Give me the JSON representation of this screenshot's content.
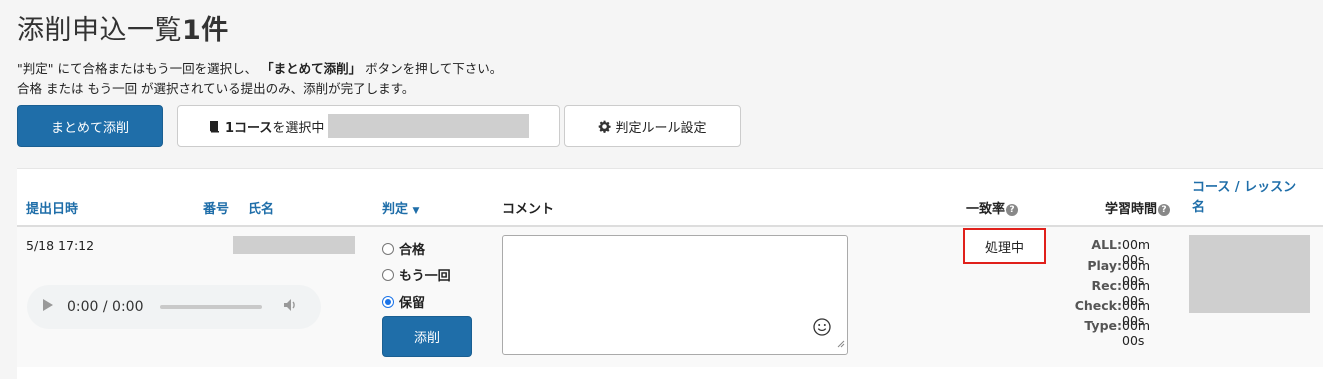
{
  "page": {
    "title": "添削申込一覧",
    "count": "1件"
  },
  "instructions": {
    "line1_a": "\"判定\" にて合格またはもう一回を選択し、",
    "line1_b": "「まとめて添削」",
    "line1_c": " ボタンを押して下さい。",
    "line2": "合格 または もう一回 が選択されている提出のみ、添削が完了します。"
  },
  "toolbar": {
    "bulk_label": "まとめて添削",
    "course_count": "1コース",
    "course_suffix": "を選択中",
    "rule_label": "判定ルール設定"
  },
  "table": {
    "headers": {
      "date": "提出日時",
      "number": "番号",
      "name": "氏名",
      "judgement": "判定",
      "comment": "コメント",
      "match_rate": "一致率",
      "study_time": "学習時間",
      "course_lesson_1": "コース / レッスン",
      "course_lesson_2": "名"
    },
    "rows": [
      {
        "date": "5/18 17:12",
        "audio_time": "0:00 / 0:00",
        "options": [
          {
            "label": "合格",
            "selected": false
          },
          {
            "label": "もう一回",
            "selected": false
          },
          {
            "label": "保留",
            "selected": true
          }
        ],
        "correct_label": "添削",
        "comment": "",
        "match_rate": "処理中",
        "stats": [
          {
            "label": "ALL:",
            "value": "00m 00s"
          },
          {
            "label": "Play:",
            "value": "00m 00s"
          },
          {
            "label": "Rec:",
            "value": "00m 00s"
          },
          {
            "label": "Check:",
            "value": "00m 00s"
          },
          {
            "label": "Type:",
            "value": "00m 00s"
          }
        ]
      }
    ]
  },
  "colors": {
    "primary": "#1f6ea9",
    "link": "#1f6ea9",
    "highlight_border": "#e0201b",
    "radio_selected": "#1a73e8"
  }
}
